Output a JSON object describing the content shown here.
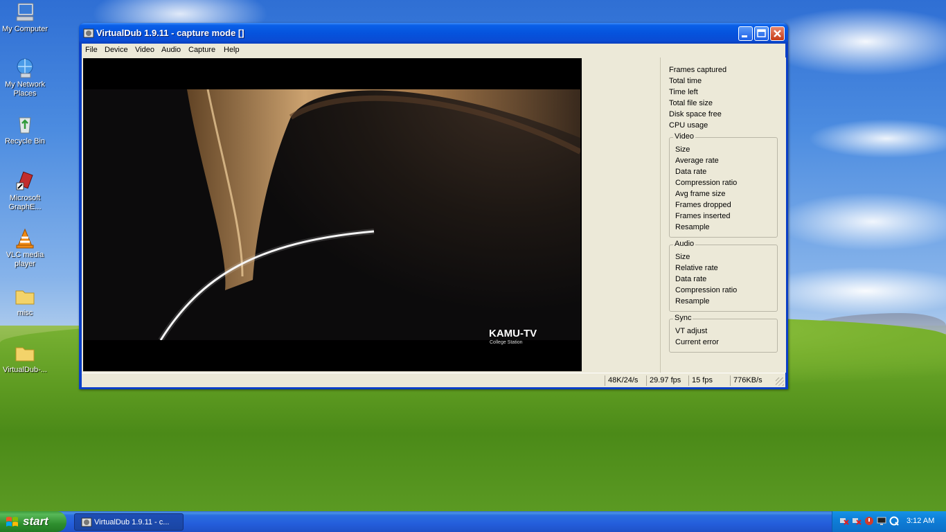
{
  "desktop": {
    "icons": [
      {
        "label": "My Computer"
      },
      {
        "label": "My Network Places"
      },
      {
        "label": "Recycle Bin"
      },
      {
        "label": "Microsoft GraphE..."
      },
      {
        "label": "VLC media player"
      },
      {
        "label": "misc"
      },
      {
        "label": "VirtualDub-..."
      }
    ]
  },
  "window": {
    "title": "VirtualDub 1.9.11 - capture mode []",
    "menu": [
      "File",
      "Device",
      "Video",
      "Audio",
      "Capture",
      "Help"
    ],
    "video_overlay": {
      "channel": "KAMU-TV",
      "subtitle": "College Station"
    },
    "stats": {
      "general": [
        "Frames captured",
        "Total time",
        "Time left",
        "Total file size",
        "Disk space free",
        "CPU usage"
      ],
      "video": {
        "title": "Video",
        "items": [
          "Size",
          "Average rate",
          "Data rate",
          "Compression ratio",
          "Avg frame size",
          "Frames dropped",
          "Frames inserted",
          "Resample"
        ]
      },
      "audio": {
        "title": "Audio",
        "items": [
          "Size",
          "Relative rate",
          "Data rate",
          "Compression ratio",
          "Resample"
        ]
      },
      "sync": {
        "title": "Sync",
        "items": [
          "VT adjust",
          "Current error"
        ]
      }
    },
    "statusbar": [
      "48K/24/s",
      "29.97 fps",
      "15 fps",
      "776KB/s"
    ]
  },
  "taskbar": {
    "start_label": "start",
    "task_label": "VirtualDub 1.9.11 - c...",
    "clock": "3:12 AM"
  }
}
